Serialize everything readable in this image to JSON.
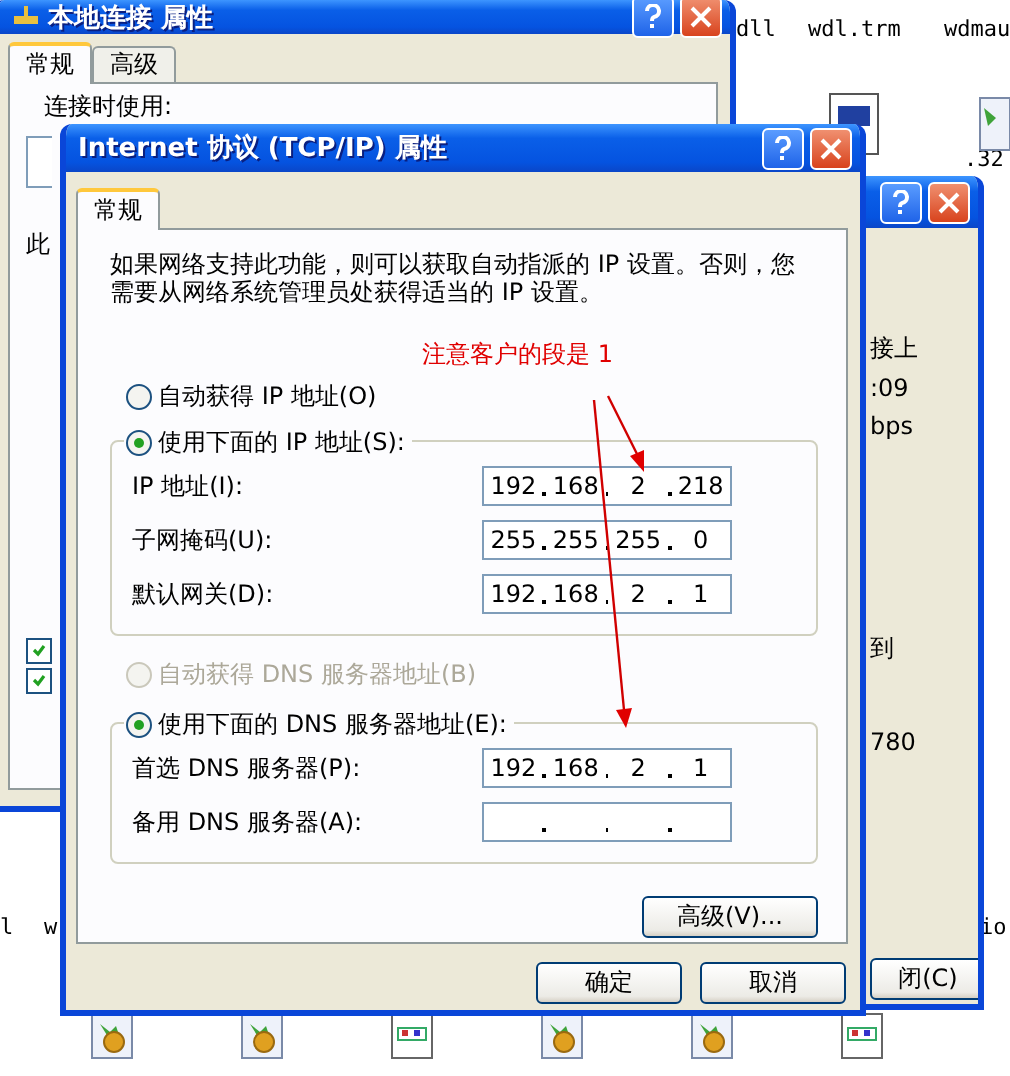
{
  "desktop": {
    "files": [
      {
        "label": "dll"
      },
      {
        "label": "wdl.trm"
      },
      {
        "label": "wdmau"
      },
      {
        "label": ".32"
      },
      {
        "label": "l"
      },
      {
        "label": "w"
      },
      {
        "label": "io"
      }
    ],
    "icons": [
      {
        "kind": "gear"
      },
      {
        "kind": "gear"
      },
      {
        "kind": "doc"
      },
      {
        "kind": "gear"
      },
      {
        "kind": "gear"
      },
      {
        "kind": "doc"
      }
    ]
  },
  "back_window": {
    "title": "本地连接 属性",
    "tabs": [
      {
        "label": "常规",
        "selected": true
      },
      {
        "label": "高级",
        "selected": false
      }
    ],
    "connect_label": "连接时使用:",
    "fragment": "此",
    "checkboxes": [
      {
        "checked": true
      },
      {
        "checked": true
      }
    ]
  },
  "status_window": {
    "texts": [
      "接上",
      ":09",
      "bps",
      "到",
      "780"
    ],
    "close_button": "闭(C)"
  },
  "dialog": {
    "title": "Internet 协议 (TCP/IP) 属性",
    "tabs": [
      {
        "label": "常规",
        "selected": true
      }
    ],
    "description": "如果网络支持此功能，则可以获取自动指派的 IP 设置。否则，您需要从网络系统管理员处获得适当的 IP 设置。",
    "annotation": "注意客户的段是 1",
    "ip_auto": {
      "label": "自动获得 IP 地址(O)",
      "selected": false,
      "disabled": false
    },
    "ip_manual": {
      "label": "使用下面的 IP 地址(S):",
      "selected": true,
      "disabled": false
    },
    "ip_fields": [
      {
        "label": "IP 地址(I):",
        "octets": [
          "192",
          "168",
          "2",
          "218"
        ]
      },
      {
        "label": "子网掩码(U):",
        "octets": [
          "255",
          "255",
          "255",
          "0"
        ]
      },
      {
        "label": "默认网关(D):",
        "octets": [
          "192",
          "168",
          "2",
          "1"
        ]
      }
    ],
    "dns_auto": {
      "label": "自动获得 DNS 服务器地址(B)",
      "selected": false,
      "disabled": true
    },
    "dns_manual": {
      "label": "使用下面的 DNS 服务器地址(E):",
      "selected": true,
      "disabled": false
    },
    "dns_fields": [
      {
        "label": "首选 DNS 服务器(P):",
        "octets": [
          "192",
          "168",
          "2",
          "1"
        ]
      },
      {
        "label": "备用 DNS 服务器(A):"
      }
    ],
    "advanced_button": "高级(V)...",
    "ok_button": "确定",
    "cancel_button": "取消"
  }
}
